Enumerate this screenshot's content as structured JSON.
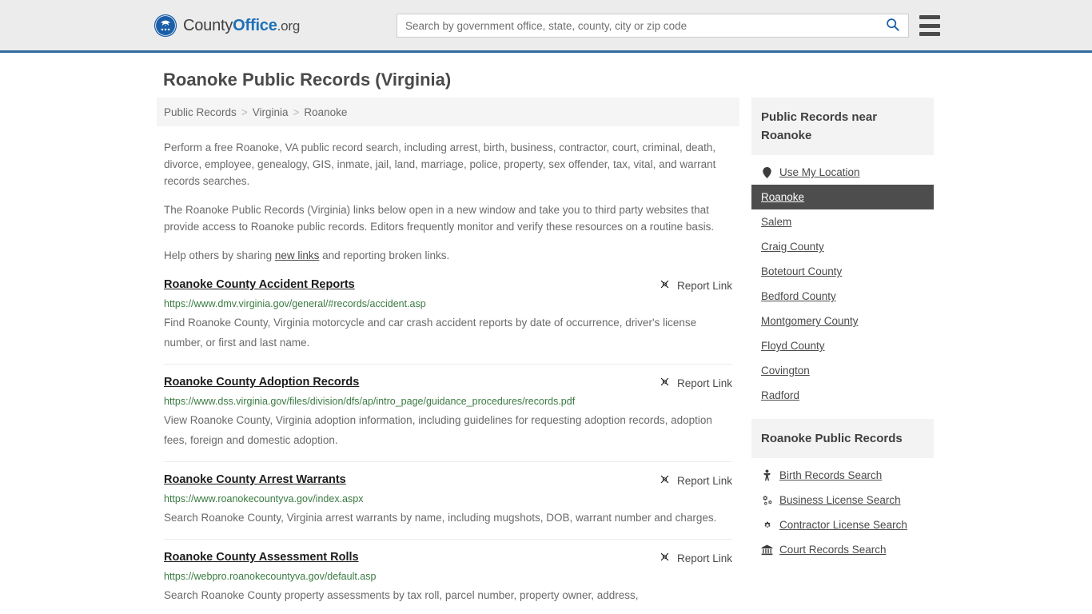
{
  "header": {
    "logo": {
      "icon": "countyoffice-eagle-logo",
      "text_part1": "County",
      "text_part2": "Office",
      "text_part3": ".org"
    },
    "search": {
      "placeholder": "Search by government office, state, county, city or zip code",
      "value": "",
      "button_icon": "search-icon"
    },
    "menu_icon": "hamburger-menu-icon",
    "accent_color": "#31699e",
    "background_color": "#ececec"
  },
  "page": {
    "title": "Roanoke Public Records (Virginia)"
  },
  "breadcrumb": {
    "items": [
      "Public Records",
      "Virginia",
      "Roanoke"
    ],
    "separator": ">"
  },
  "intro": {
    "paragraph1": "Perform a free Roanoke, VA public record search, including arrest, birth, business, contractor, court, criminal, death, divorce, employee, genealogy, GIS, inmate, jail, land, marriage, police, property, sex offender, tax, vital, and warrant records searches.",
    "paragraph2": "The Roanoke Public Records (Virginia) links below open in a new window and take you to third party websites that provide access to Roanoke public records. Editors frequently monitor and verify these resources on a routine basis.",
    "help_prefix": "Help others by sharing ",
    "help_link": "new links",
    "help_suffix": " and reporting broken links."
  },
  "results": {
    "report_label": "Report Link",
    "report_icon": "broken-link-icon",
    "items": [
      {
        "title": "Roanoke County Accident Reports",
        "url": "https://www.dmv.virginia.gov/general/#records/accident.asp",
        "description": "Find Roanoke County, Virginia motorcycle and car crash accident reports by date of occurrence, driver's license number, or first and last name."
      },
      {
        "title": "Roanoke County Adoption Records",
        "url": "https://www.dss.virginia.gov/files/division/dfs/ap/intro_page/guidance_procedures/records.pdf",
        "description": "View Roanoke County, Virginia adoption information, including guidelines for requesting adoption records, adoption fees, foreign and domestic adoption."
      },
      {
        "title": "Roanoke County Arrest Warrants",
        "url": "https://www.roanokecountyva.gov/index.aspx",
        "description": "Search Roanoke County, Virginia arrest warrants by name, including mugshots, DOB, warrant number and charges."
      },
      {
        "title": "Roanoke County Assessment Rolls",
        "url": "https://webpro.roanokecountyva.gov/default.asp",
        "description": "Search Roanoke County property assessments by tax roll, parcel number, property owner, address,"
      }
    ]
  },
  "sidebar": {
    "nearby": {
      "heading": "Public Records near Roanoke",
      "items": [
        {
          "label": "Use My Location",
          "icon": "map-pin-icon",
          "active": false
        },
        {
          "label": "Roanoke",
          "icon": "",
          "active": true
        },
        {
          "label": "Salem",
          "icon": "",
          "active": false
        },
        {
          "label": "Craig County",
          "icon": "",
          "active": false
        },
        {
          "label": "Botetourt County",
          "icon": "",
          "active": false
        },
        {
          "label": "Bedford County",
          "icon": "",
          "active": false
        },
        {
          "label": "Montgomery County",
          "icon": "",
          "active": false
        },
        {
          "label": "Floyd County",
          "icon": "",
          "active": false
        },
        {
          "label": "Covington",
          "icon": "",
          "active": false
        },
        {
          "label": "Radford",
          "icon": "",
          "active": false
        }
      ]
    },
    "records": {
      "heading": "Roanoke Public Records",
      "items": [
        {
          "label": "Birth Records Search",
          "icon": "baby-icon"
        },
        {
          "label": "Business License Search",
          "icon": "cogs-icon"
        },
        {
          "label": "Contractor License Search",
          "icon": "cog-icon"
        },
        {
          "label": "Court Records Search",
          "icon": "bank-icon"
        }
      ]
    },
    "active_background": "#4d4d4d",
    "heading_background": "#f3f3f3"
  }
}
